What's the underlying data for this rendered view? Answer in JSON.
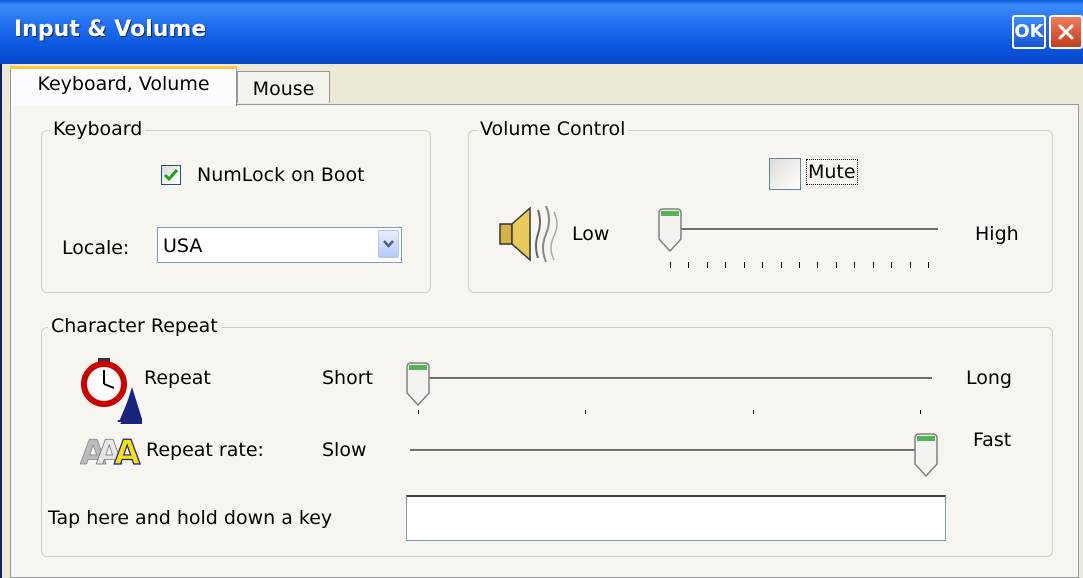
{
  "window": {
    "title": "Input & Volume",
    "ok_label": "OK"
  },
  "tabs": [
    {
      "label": "Keyboard, Volume",
      "active": true
    },
    {
      "label": "Mouse",
      "active": false
    }
  ],
  "keyboard": {
    "group_label": "Keyboard",
    "numlock_label": "NumLock on Boot",
    "numlock_checked": true,
    "locale_label": "Locale:",
    "locale_value": "USA"
  },
  "volume": {
    "group_label": "Volume Control",
    "mute_label": "Mute",
    "mute_checked": false,
    "low_label": "Low",
    "high_label": "High",
    "level": 0
  },
  "char_repeat": {
    "group_label": "Character Repeat",
    "repeat_label": "Repeat",
    "short_label": "Short",
    "long_label": "Long",
    "repeat_delay_level": 0,
    "rate_label": "Repeat rate:",
    "slow_label": "Slow",
    "fast_label": "Fast",
    "repeat_rate_level": 1,
    "tap_label": "Tap here and hold down a key",
    "tap_value": ""
  },
  "colors": {
    "title_bar": "#0b55de",
    "face": "#ece9d8",
    "check": "#21a121"
  }
}
